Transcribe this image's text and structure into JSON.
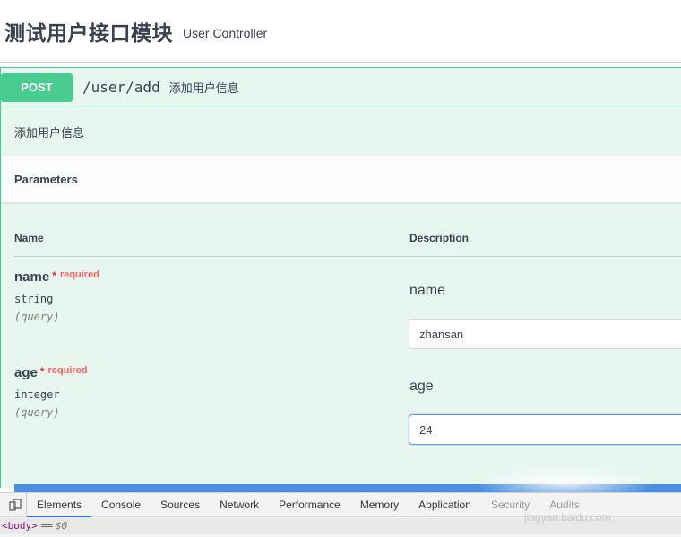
{
  "tag": {
    "title": "测试用户接口模块",
    "description": "User Controller"
  },
  "operation": {
    "method": "POST",
    "path": "/user/add",
    "summary": "添加用户信息",
    "description": "添加用户信息",
    "parameters_title": "Parameters",
    "columns": {
      "name": "Name",
      "description": "Description"
    },
    "params": [
      {
        "name": "name",
        "star": "*",
        "required": "required",
        "type": "string",
        "in": "(query)",
        "label": "name",
        "value": "zhansan"
      },
      {
        "name": "age",
        "star": "*",
        "required": "required",
        "type": "integer",
        "in": "(query)",
        "label": "age",
        "value": "24"
      }
    ]
  },
  "devtools": {
    "tabs": [
      "Elements",
      "Console",
      "Sources",
      "Network",
      "Performance",
      "Memory",
      "Application",
      "Security",
      "Audits"
    ],
    "active_tab": "Elements",
    "breadcrumb": {
      "tag": "<body>",
      "eq": "==",
      "var": "$0"
    },
    "watermark": "jingyan.baidu.com"
  },
  "colors": {
    "post": "#49cc90",
    "opblock_bg": "#e8f6f0",
    "execute": "#4990e2",
    "required": "#ff6060"
  }
}
